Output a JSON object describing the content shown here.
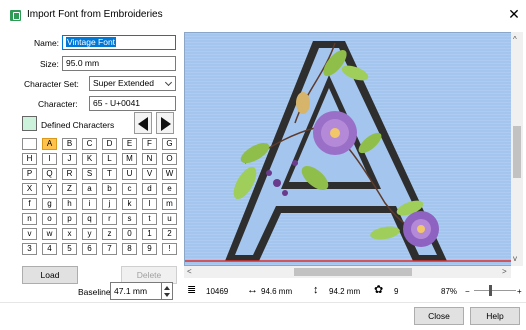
{
  "window": {
    "title": "Import Font from Embroideries",
    "app_icon": "embroidery-app-icon",
    "close_glyph": "✕"
  },
  "form": {
    "name_label": "Name:",
    "name_value": "Vintage Font",
    "size_label": "Size:",
    "size_value": "95.0 mm",
    "charset_label": "Character Set:",
    "charset_value": "Super Extended",
    "character_label": "Character:",
    "character_value": "65 - U+0041"
  },
  "defined_characters": {
    "label": "Defined Characters",
    "swatch_color": "#ccf2dc",
    "selected": "A",
    "grid": [
      [
        "",
        "A",
        "B",
        "C",
        "D",
        "E",
        "F",
        "G"
      ],
      [
        "H",
        "I",
        "J",
        "K",
        "L",
        "M",
        "N",
        "O"
      ],
      [
        "P",
        "Q",
        "R",
        "S",
        "T",
        "U",
        "V",
        "W"
      ],
      [
        "X",
        "Y",
        "Z",
        "a",
        "b",
        "c",
        "d",
        "e"
      ],
      [
        "f",
        "g",
        "h",
        "i",
        "j",
        "k",
        "l",
        "m"
      ],
      [
        "n",
        "o",
        "p",
        "q",
        "r",
        "s",
        "t",
        "u"
      ],
      [
        "v",
        "w",
        "x",
        "y",
        "z",
        "0",
        "1",
        "2"
      ],
      [
        "3",
        "4",
        "5",
        "6",
        "7",
        "8",
        "9",
        "!"
      ]
    ]
  },
  "buttons": {
    "load": "Load",
    "delete": "Delete",
    "close": "Close",
    "help": "Help"
  },
  "baseline": {
    "label": "Baseline:",
    "value": "47.1 mm"
  },
  "status": {
    "stitches": "10469",
    "width": "94.6 mm",
    "height": "94.2 mm",
    "colors": "9",
    "zoom": "87%",
    "zoom_minus": "−",
    "zoom_plus": "+"
  },
  "colors": {
    "preview_bg": "#a3c5ee",
    "selected_cell": "#ffc34d",
    "baseline_line": "#e0312f",
    "letter_outline": "#3a3a3a",
    "flower_purple": "#9a6fc8",
    "leaf_green": "#8fbf4a"
  }
}
